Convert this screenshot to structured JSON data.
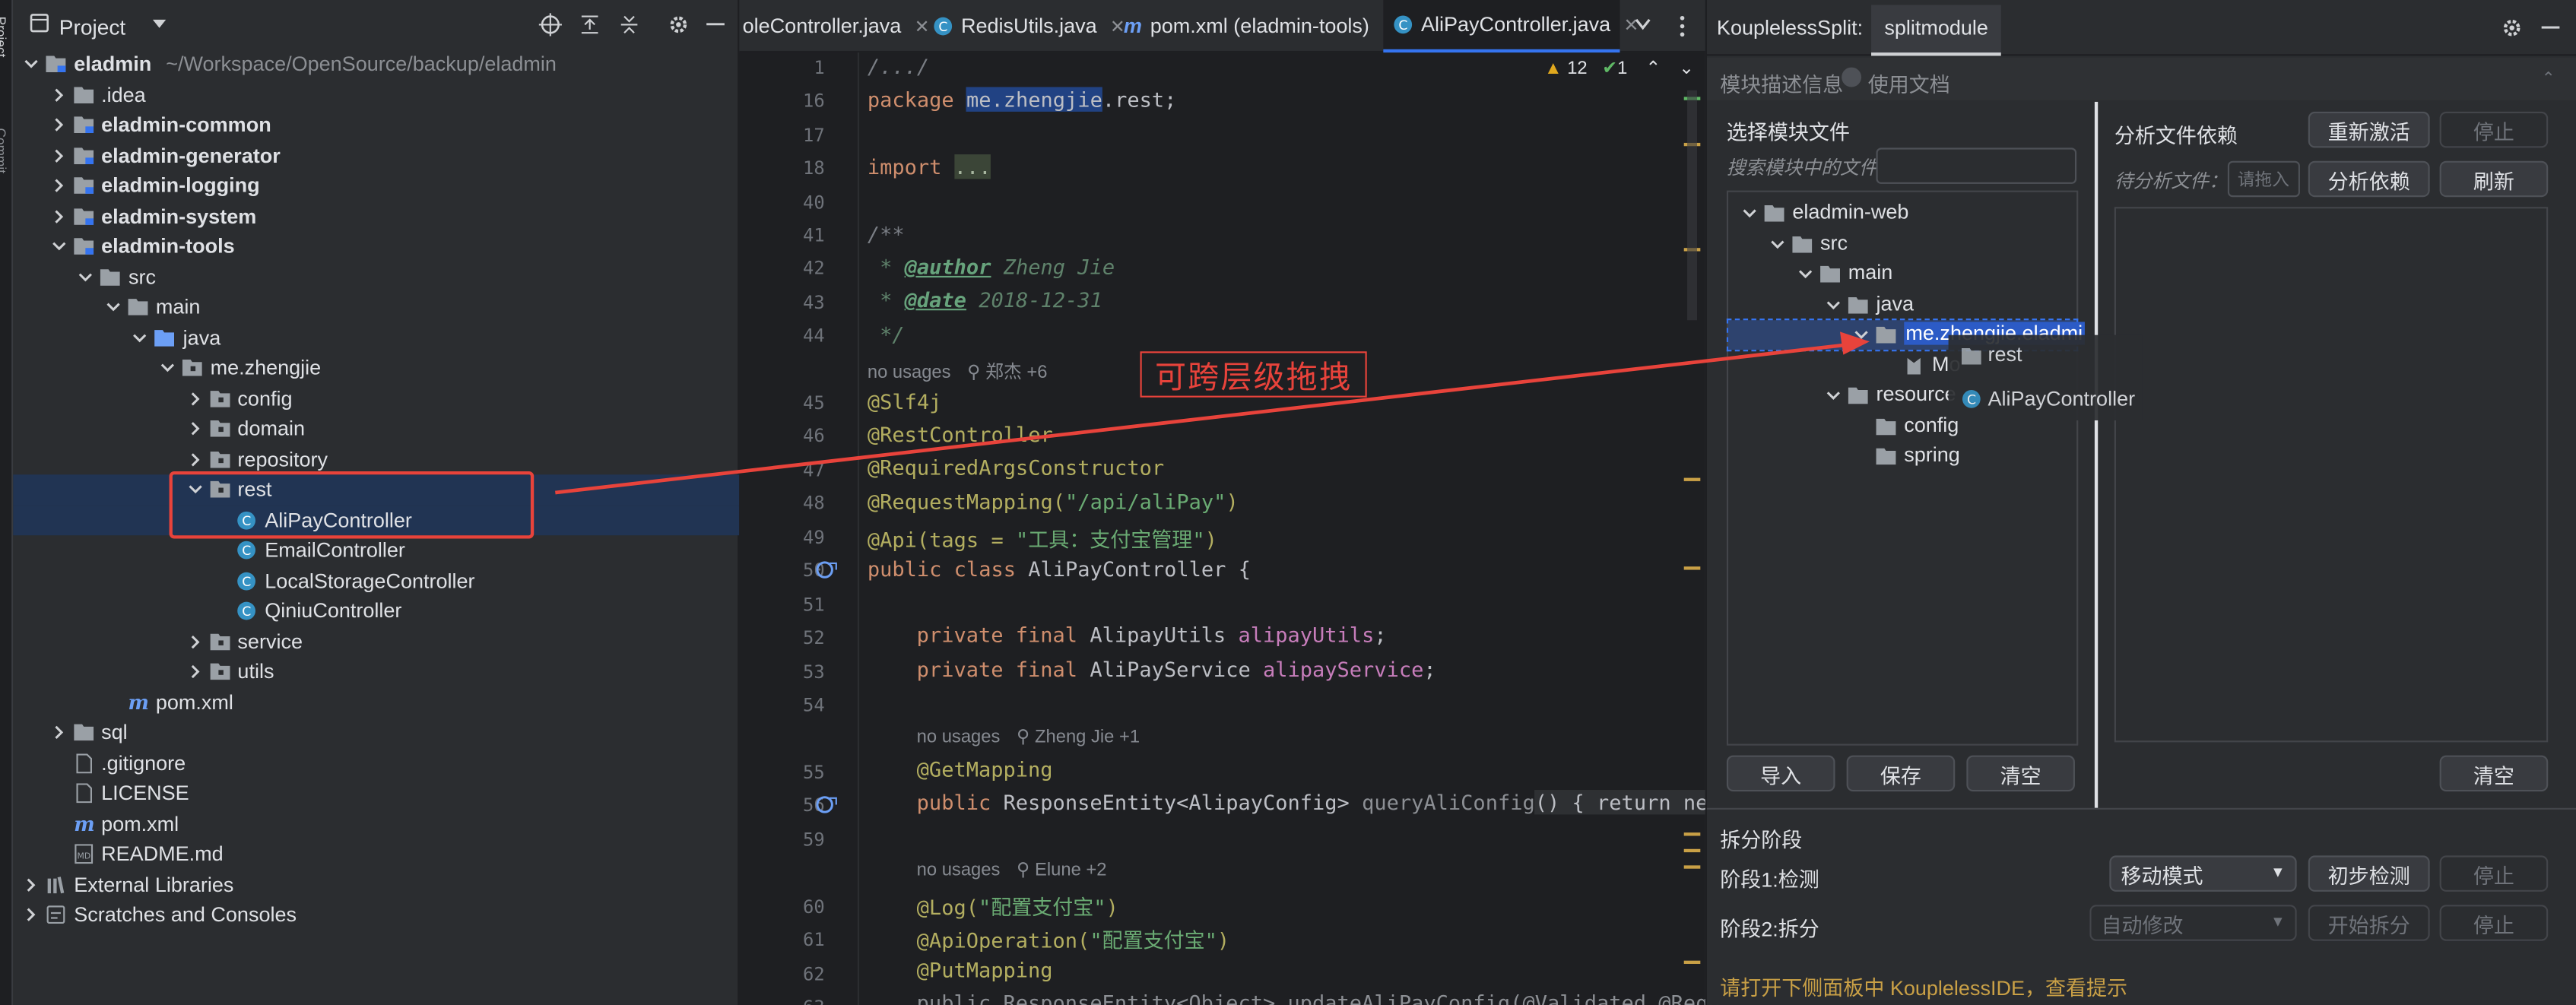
{
  "left_strip": {
    "label": "Project",
    "label2": "Commit"
  },
  "project_panel": {
    "title": "Project",
    "tree": [
      {
        "label": "eladmin",
        "extra": "~/Workspace/OpenSource/backup/eladmin",
        "indent": 0,
        "expanded": true,
        "icon": "module-folder-icon",
        "bold": true
      },
      {
        "label": ".idea",
        "indent": 1,
        "expanded": false,
        "icon": "folder-icon"
      },
      {
        "label": "eladmin-common",
        "indent": 1,
        "expanded": false,
        "icon": "module-folder-icon",
        "bold": true
      },
      {
        "label": "eladmin-generator",
        "indent": 1,
        "expanded": false,
        "icon": "module-folder-icon",
        "bold": true
      },
      {
        "label": "eladmin-logging",
        "indent": 1,
        "expanded": false,
        "icon": "module-folder-icon",
        "bold": true
      },
      {
        "label": "eladmin-system",
        "indent": 1,
        "expanded": false,
        "icon": "module-folder-icon",
        "bold": true
      },
      {
        "label": "eladmin-tools",
        "indent": 1,
        "expanded": true,
        "icon": "module-folder-icon",
        "bold": true
      },
      {
        "label": "src",
        "indent": 2,
        "expanded": true,
        "icon": "folder-icon"
      },
      {
        "label": "main",
        "indent": 3,
        "expanded": true,
        "icon": "folder-icon"
      },
      {
        "label": "java",
        "indent": 4,
        "expanded": true,
        "icon": "source-folder-icon"
      },
      {
        "label": "me.zhengjie",
        "indent": 5,
        "expanded": true,
        "icon": "package-icon"
      },
      {
        "label": "config",
        "indent": 6,
        "expanded": false,
        "icon": "package-icon"
      },
      {
        "label": "domain",
        "indent": 6,
        "expanded": false,
        "icon": "package-icon"
      },
      {
        "label": "repository",
        "indent": 6,
        "expanded": false,
        "icon": "package-icon"
      },
      {
        "label": "rest",
        "indent": 6,
        "expanded": true,
        "icon": "package-icon",
        "selected": true
      },
      {
        "label": "AliPayController",
        "indent": 7,
        "icon": "class-icon",
        "selected": true
      },
      {
        "label": "EmailController",
        "indent": 7,
        "icon": "class-icon"
      },
      {
        "label": "LocalStorageController",
        "indent": 7,
        "icon": "class-icon"
      },
      {
        "label": "QiniuController",
        "indent": 7,
        "icon": "class-icon"
      },
      {
        "label": "service",
        "indent": 6,
        "expanded": false,
        "icon": "package-icon"
      },
      {
        "label": "utils",
        "indent": 6,
        "expanded": false,
        "icon": "package-icon"
      },
      {
        "label": "pom.xml",
        "indent": 3,
        "icon": "maven-icon"
      },
      {
        "label": "sql",
        "indent": 1,
        "expanded": false,
        "icon": "folder-icon"
      },
      {
        "label": ".gitignore",
        "indent": 1,
        "icon": "file-icon"
      },
      {
        "label": "LICENSE",
        "indent": 1,
        "icon": "file-icon"
      },
      {
        "label": "pom.xml",
        "indent": 1,
        "icon": "maven-icon"
      },
      {
        "label": "README.md",
        "indent": 1,
        "icon": "markdown-icon"
      },
      {
        "label": "External Libraries",
        "indent": 0,
        "expanded": false,
        "icon": "library-icon"
      },
      {
        "label": "Scratches and Consoles",
        "indent": 0,
        "expanded": false,
        "icon": "scratch-icon"
      }
    ]
  },
  "editor": {
    "tabs": [
      {
        "label": "oleController.java",
        "icon": "class-icon"
      },
      {
        "label": "RedisUtils.java",
        "icon": "class-icon"
      },
      {
        "label": "pom.xml (eladmin-tools)",
        "icon": "maven-icon"
      },
      {
        "label": "AliPayController.java",
        "icon": "class-icon",
        "active": true
      }
    ],
    "inspections": {
      "warnings": "12",
      "checks": "1"
    },
    "line_numbers": [
      "1",
      "16",
      "17",
      "18",
      "40",
      "41",
      "42",
      "43",
      "44",
      "45",
      "46",
      "47",
      "48",
      "49",
      "50",
      "51",
      "52",
      "53",
      "54",
      "55",
      "56",
      "59",
      "60",
      "61",
      "62",
      "63"
    ],
    "hints": {
      "h1": "no usages",
      "h1b": "郑杰 +6",
      "h2": "no usages",
      "h2b": "Zheng Jie +1",
      "h3": "no usages",
      "h3b": "Elune +2"
    },
    "code": {
      "l1": "/.../",
      "l16a": "package ",
      "l16b": "me.zhengjie",
      "l16c": ".rest;",
      "l18a": "import ",
      "l18b": "...",
      "l41": "/**",
      "l42a": " * ",
      "l42b": "@author",
      "l42c": " Zheng Jie",
      "l43a": " * ",
      "l43b": "@date",
      "l43c": " 2018-12-31",
      "l44": " */",
      "l45": "@Slf4j",
      "l46": "@RestController",
      "l47": "@RequiredArgsConstructor",
      "l48a": "@RequestMapping(",
      "l48b": "\"/api/aliPay\"",
      "l48c": ")",
      "l49a": "@Api(tags = ",
      "l49b": "\"工具：支付宝管理\"",
      "l49c": ")",
      "l50a": "public class ",
      "l50b": "AliPayController {",
      "l52a": "private final ",
      "l52b": "AlipayUtils ",
      "l52c": "alipayUtils",
      ";": ";",
      "l53a": "private final ",
      "l53b": "AliPayService ",
      "l53c": "alipayService",
      "l55": "@GetMapping",
      "l56a": "public ",
      "l56b": "ResponseEntity<AlipayConfig> ",
      "l56c": "queryAliConfig",
      "l56d": "() { return new",
      "l60a": "@Log(",
      "l60b": "\"配置支付宝\"",
      "l60c": ")",
      "l61a": "@ApiOperation(",
      "l61b": "\"配置支付宝\"",
      "l61c": ")",
      "l62": "@PutMapping",
      "l63": "public ResponseEntity<Object> updateAliPayConfig(@Validated @Requ"
    }
  },
  "annotation": {
    "label": "可跨层级拖拽"
  },
  "split_panel": {
    "title": "KouplelessSplit:",
    "tab": "splitmodule",
    "info_label": "模块描述信息",
    "doc_label": "使用文档",
    "select_label": "选择模块文件",
    "search_label": "搜索模块中的文件",
    "analyze_label": "分析文件依赖",
    "reactivate": "重新激活",
    "stop": "停止",
    "pending_label": "待分析文件：",
    "drag_placeholder": "请拖入",
    "analyze_btn": "分析依赖",
    "refresh": "刷新",
    "tree": [
      {
        "label": "eladmin-web",
        "indent": 0
      },
      {
        "label": "src",
        "indent": 1
      },
      {
        "label": "main",
        "indent": 2
      },
      {
        "label": "java",
        "indent": 3
      },
      {
        "label": "me.zhengjie.eladmi",
        "indent": 4,
        "selected": true
      },
      {
        "label": "Mo",
        "indent": 5
      },
      {
        "label": "resource",
        "indent": 3
      },
      {
        "label": "config",
        "indent": 4
      },
      {
        "label": "spring",
        "indent": 4
      }
    ],
    "drag_ghost": [
      "rest",
      "AliPayController"
    ],
    "import": "导入",
    "save": "保存",
    "clear": "清空",
    "clear2": "清空",
    "phase_title": "拆分阶段",
    "phase1": "阶段1:检测",
    "mode1": "移动模式",
    "detect": "初步检测",
    "stop1": "停止",
    "phase2": "阶段2:拆分",
    "mode2": "自动修改",
    "start_split": "开始拆分",
    "stop2": "停止",
    "footer": "请打开下侧面板中 KouplelessIDE，查看提示"
  }
}
